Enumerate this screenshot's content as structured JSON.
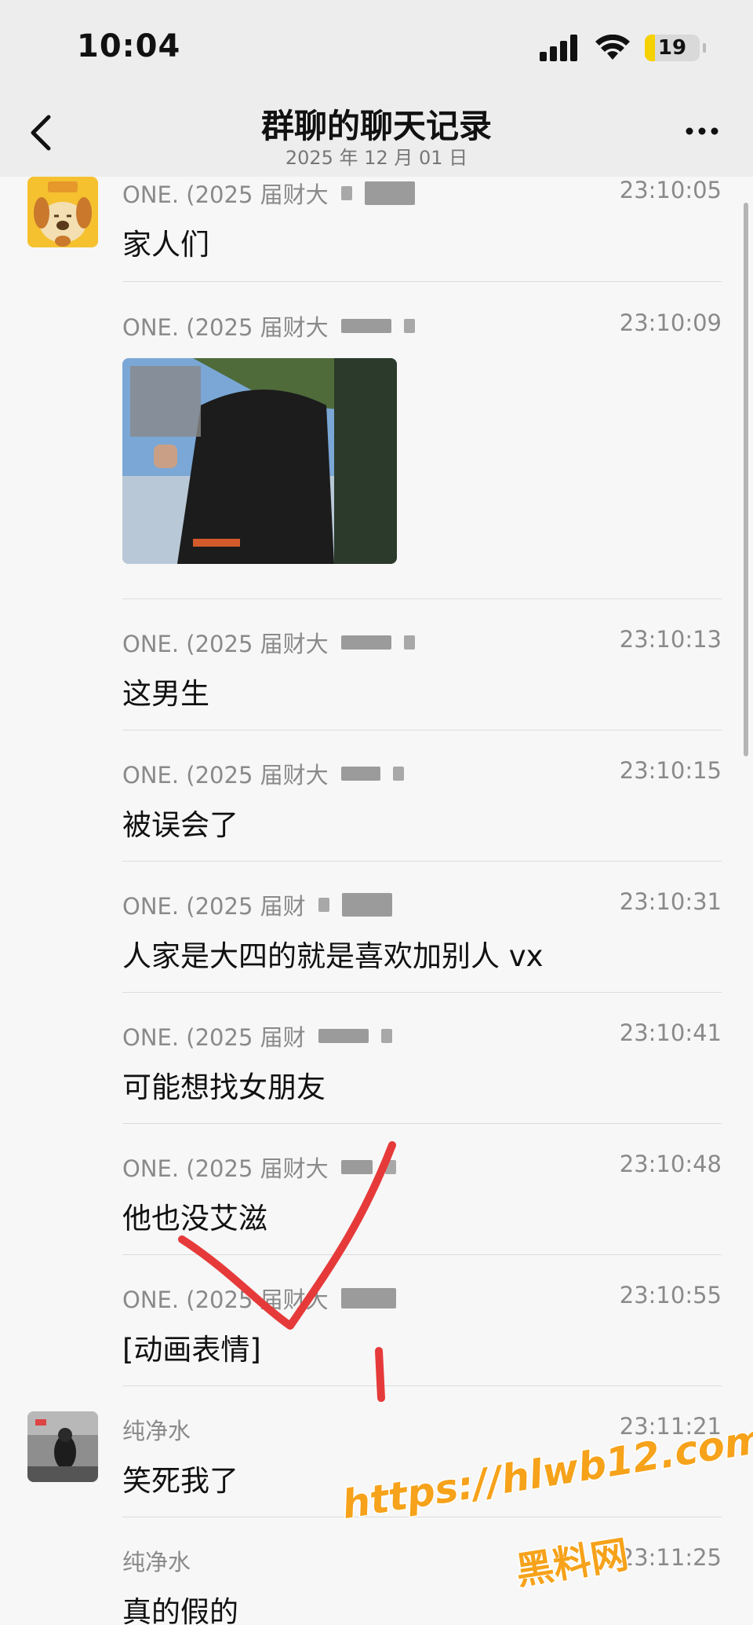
{
  "status": {
    "time": "10:04",
    "battery": "19",
    "battery_level": 0.19
  },
  "header": {
    "title": "群聊的聊天记录",
    "subtitle": "2025 年 12 月 01 日"
  },
  "messages": [
    {
      "sender": "ONE. (2025 届财大",
      "time": "23:10:05",
      "text": "家人们",
      "avatar": "dog-sticker"
    },
    {
      "sender": "ONE. (2025 届财大",
      "time": "23:10:09",
      "text": "",
      "image": true
    },
    {
      "sender": "ONE. (2025 届财大",
      "time": "23:10:13",
      "text": "这男生"
    },
    {
      "sender": "ONE. (2025 届财大",
      "time": "23:10:15",
      "text": "被误会了"
    },
    {
      "sender": "ONE. (2025 届财",
      "time": "23:10:31",
      "text": "人家是大四的就是喜欢加别人 vx"
    },
    {
      "sender": "ONE. (2025 届财",
      "time": "23:10:41",
      "text": "可能想找女朋友"
    },
    {
      "sender": "ONE. (2025 届财大",
      "time": "23:10:48",
      "text": "他也没艾滋"
    },
    {
      "sender": "ONE. (2025 届财大",
      "time": "23:10:55",
      "text": "[动画表情]"
    },
    {
      "sender": "纯净水",
      "time": "23:11:21",
      "text": "笑死我了",
      "avatar": "photo"
    },
    {
      "sender": "纯净水",
      "time": "23:11:25",
      "text": "真的假的"
    }
  ],
  "watermark": {
    "url": "https://hlwb12.com",
    "name": "黑料网"
  },
  "colors": {
    "accent": "#f6a21a",
    "annotation": "#e63a3a"
  }
}
